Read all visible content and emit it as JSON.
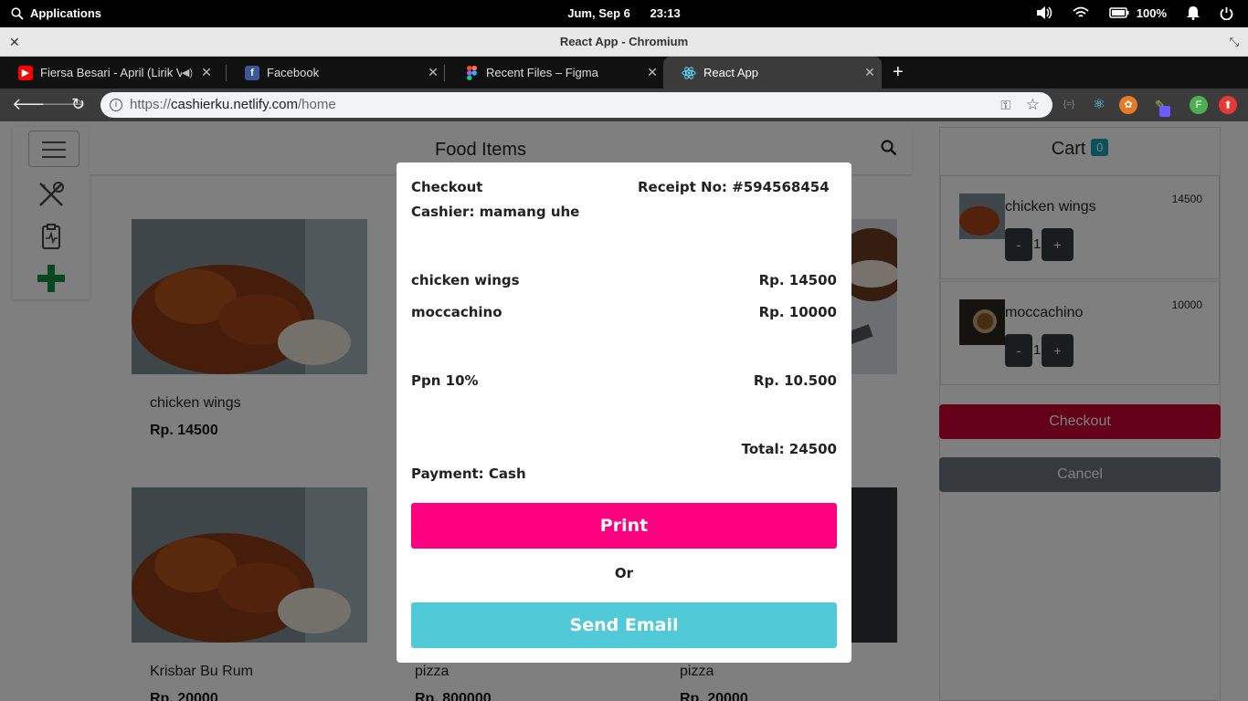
{
  "os": {
    "apps_label": "Applications",
    "date": "Jum, Sep  6",
    "time": "23:13",
    "battery": "100%"
  },
  "window": {
    "title": "React App - Chromium"
  },
  "tabs": [
    {
      "title": "Fiersa Besari - April (Lirik Video)",
      "icon": "youtube-icon",
      "color": "#ff0000"
    },
    {
      "title": "Facebook",
      "icon": "facebook-icon",
      "color": "#3b5998"
    },
    {
      "title": "Recent Files – Figma",
      "icon": "figma-icon",
      "color": "#f24e1e"
    },
    {
      "title": "React App",
      "icon": "react-icon",
      "color": "#61dafb"
    }
  ],
  "address": {
    "scheme": "https://",
    "host": "cashierku.netlify.com",
    "path": "/home"
  },
  "page": {
    "header_title": "Food Items",
    "foods": [
      {
        "name": "chicken wings",
        "price": "Rp. 14500"
      },
      {
        "name": "Krisbar Bu Rum",
        "price": "Rp. 20000"
      },
      {
        "name": "pizza",
        "price": "Rp. 800000"
      },
      {
        "name": "pizza",
        "price": "Rp. 20000"
      }
    ],
    "cart": {
      "title": "Cart",
      "badge": "0",
      "items": [
        {
          "name": "chicken wings",
          "price": "14500",
          "qty": "1",
          "minus": "-",
          "plus": "+"
        },
        {
          "name": "moccachino",
          "price": "10000",
          "qty": "1",
          "minus": "-",
          "plus": "+"
        }
      ],
      "checkout_label": "Checkout",
      "cancel_label": "Cancel"
    }
  },
  "modal": {
    "title": "Checkout",
    "receipt": "Receipt No: #594568454",
    "cashier": "Cashier: mamang uhe",
    "lines": [
      {
        "name": "chicken wings",
        "amount": "Rp. 14500"
      },
      {
        "name": "moccachino",
        "amount": "Rp. 10000"
      }
    ],
    "tax_label": "Ppn 10%",
    "tax_amount": "Rp. 10.500",
    "total": "Total: 24500",
    "payment": "Payment: Cash",
    "print_label": "Print",
    "or_label": "Or",
    "email_label": "Send Email"
  },
  "colors": {
    "checkout": "#c8002f",
    "cancel": "#6c757d",
    "print": "#ff0080",
    "email": "#4fcad6",
    "plus_icon": "#0f8c3c"
  }
}
